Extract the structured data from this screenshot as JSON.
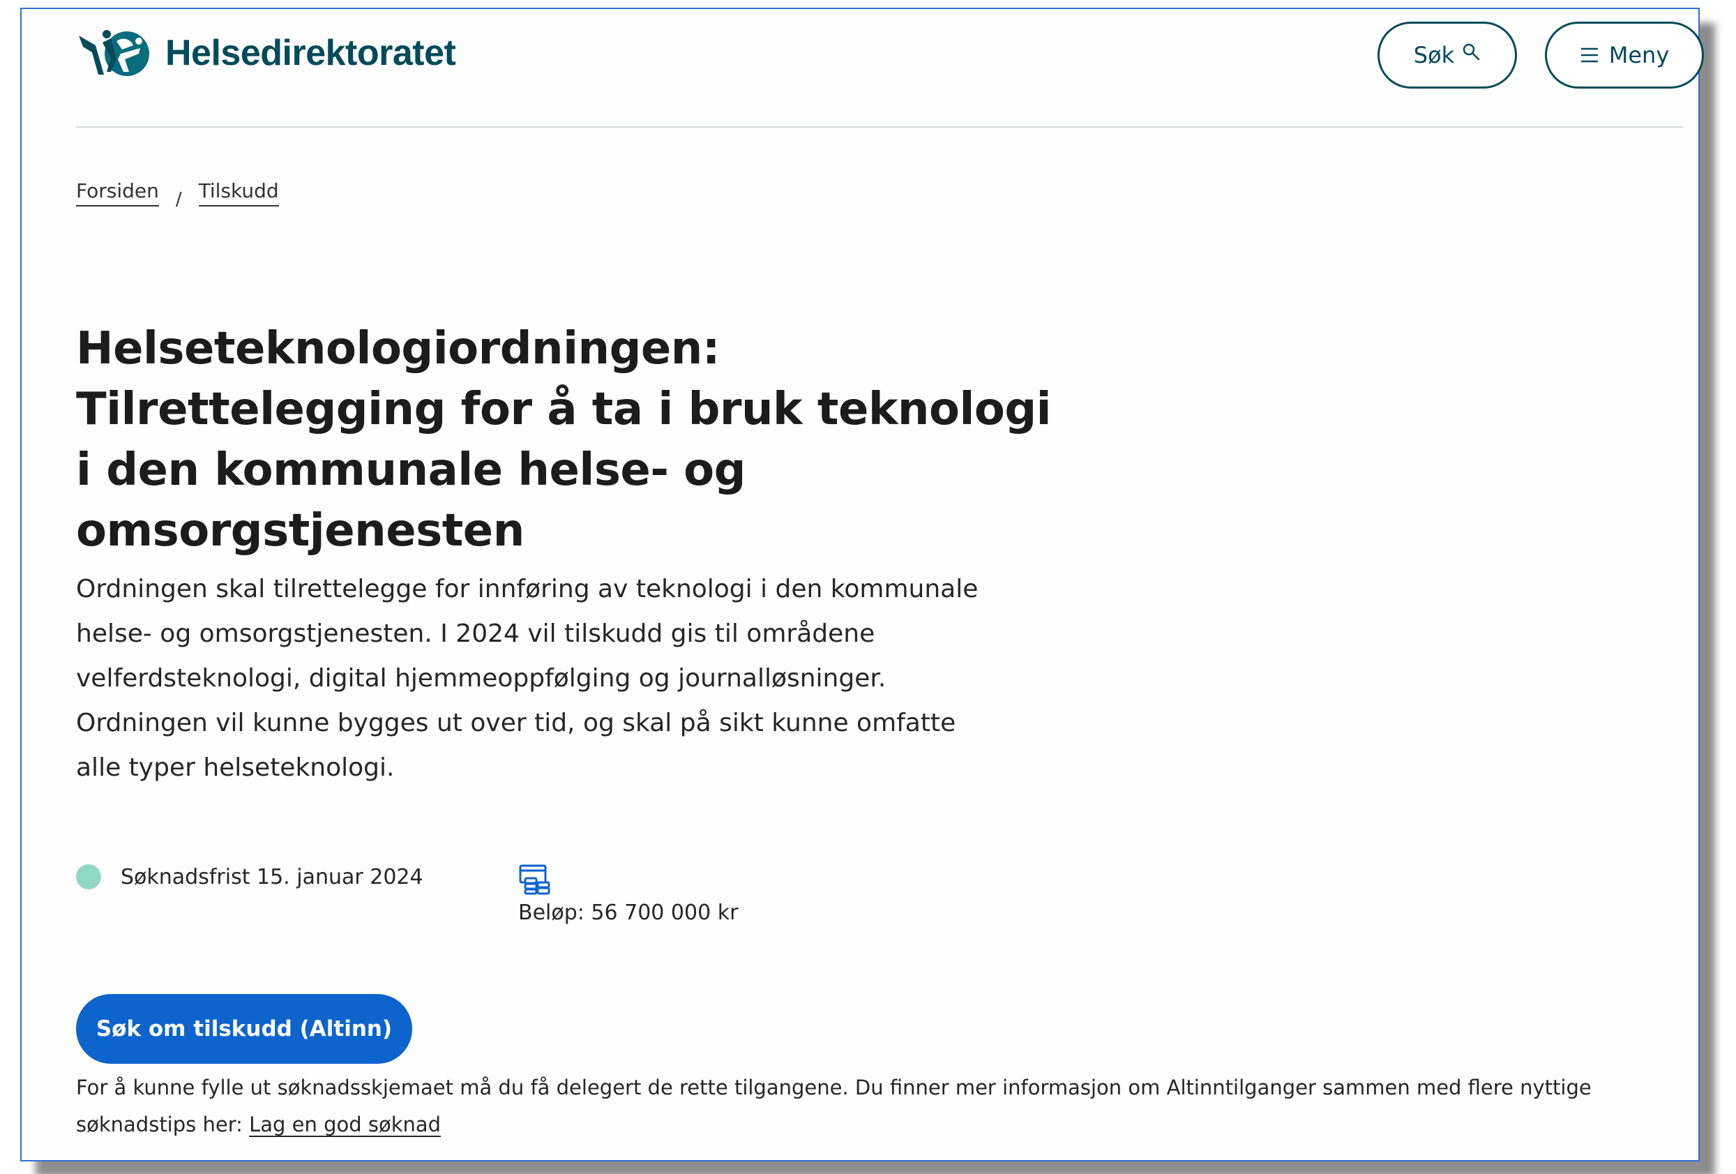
{
  "header": {
    "logo_text": "Helsedirektoratet",
    "search_label": "Søk",
    "menu_label": "Meny"
  },
  "breadcrumb": [
    "Forsiden",
    "Tilskudd"
  ],
  "breadcrumb_separator": "/",
  "page": {
    "title_lines": [
      "Helseteknologiordningen:",
      "Tilrettelegging for å ta i bruk teknologi",
      "i den kommunale helse- og",
      "omsorgstjenesten"
    ],
    "lead_lines": [
      "Ordningen skal tilrettelegge for innføring av teknologi i den kommunale",
      "helse- og omsorgstjenesten. I 2024 vil tilskudd gis til områdene",
      "velferdsteknologi, digital hjemmeoppfølging og journalløsninger.",
      "Ordningen vil kunne bygges ut over tid, og skal på sikt kunne omfatte",
      "alle typer helseteknologi."
    ],
    "deadline": "Søknadsfrist 15. januar 2024",
    "amount": "Beløp: 56 700 000 kr",
    "cta_label": "Søk om tilskudd (Altinn)",
    "note_text": "For å kunne fylle ut søknadsskjemaet må du få delegert de rette tilgangene. Du finner mer informasjon om Altinntilganger sammen med flere nyttige søknadstips her: ",
    "note_link": "Lag en god søknad"
  },
  "colors": {
    "brand": "#024b5a",
    "cta": "#0d64cc",
    "status_dot": "#8fd8c5",
    "frame_border": "#2f6fd1"
  },
  "icons": [
    "logo-icon",
    "search-icon",
    "menu-icon",
    "money-icon"
  ]
}
